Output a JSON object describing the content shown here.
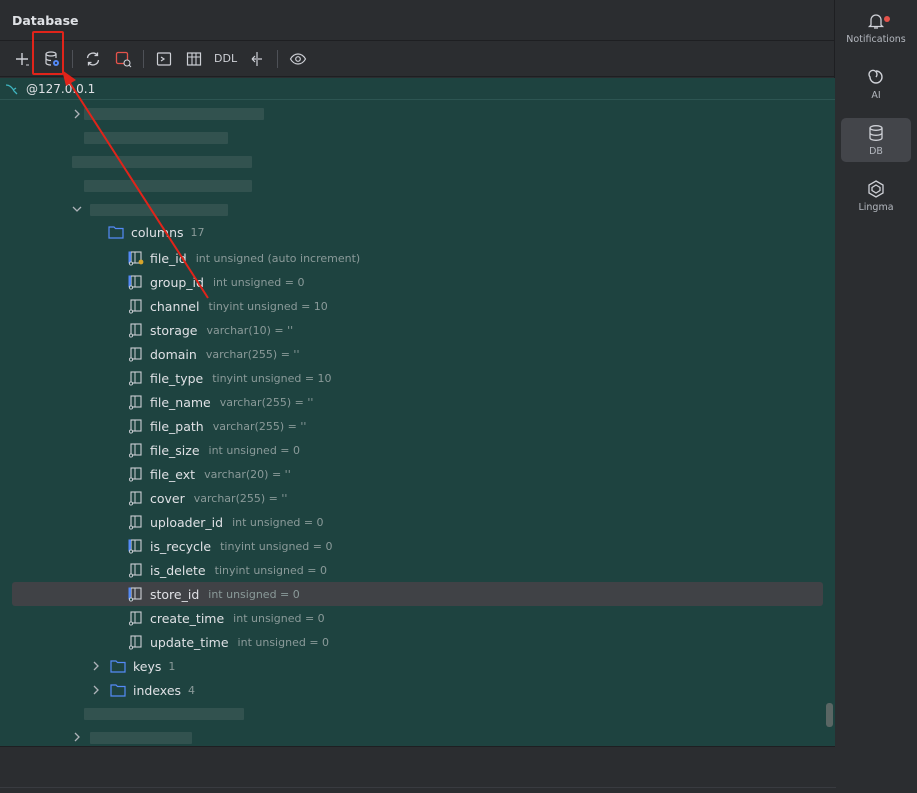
{
  "panel": {
    "title": "Database"
  },
  "toolbar": {
    "ddl_label": "DDL"
  },
  "connection": {
    "host": "@127.0.0.1"
  },
  "tree": {
    "columns_folder": {
      "label": "columns",
      "count": "17"
    },
    "columns": [
      {
        "name": "file_id",
        "type": "int unsigned (auto increment)"
      },
      {
        "name": "group_id",
        "type": "int unsigned = 0"
      },
      {
        "name": "channel",
        "type": "tinyint unsigned = 10"
      },
      {
        "name": "storage",
        "type": "varchar(10) = ''"
      },
      {
        "name": "domain",
        "type": "varchar(255) = ''"
      },
      {
        "name": "file_type",
        "type": "tinyint unsigned = 10"
      },
      {
        "name": "file_name",
        "type": "varchar(255) = ''"
      },
      {
        "name": "file_path",
        "type": "varchar(255) = ''"
      },
      {
        "name": "file_size",
        "type": "int unsigned = 0"
      },
      {
        "name": "file_ext",
        "type": "varchar(20) = ''"
      },
      {
        "name": "cover",
        "type": "varchar(255) = ''"
      },
      {
        "name": "uploader_id",
        "type": "int unsigned = 0"
      },
      {
        "name": "is_recycle",
        "type": "tinyint unsigned = 0"
      },
      {
        "name": "is_delete",
        "type": "tinyint unsigned = 0"
      },
      {
        "name": "store_id",
        "type": "int unsigned = 0"
      },
      {
        "name": "create_time",
        "type": "int unsigned = 0"
      },
      {
        "name": "update_time",
        "type": "int unsigned = 0"
      }
    ],
    "keys_folder": {
      "label": "keys",
      "count": "1"
    },
    "indexes_folder": {
      "label": "indexes",
      "count": "4"
    }
  },
  "sidebar": {
    "notifications": "Notifications",
    "ai": "AI",
    "db": "DB",
    "lingma": "Lingma"
  },
  "colors": {
    "tree_bg": "#1e4340",
    "panel_bg": "#2b2d30",
    "annotation_red": "#e0241a",
    "folder_blue": "#548af7"
  }
}
